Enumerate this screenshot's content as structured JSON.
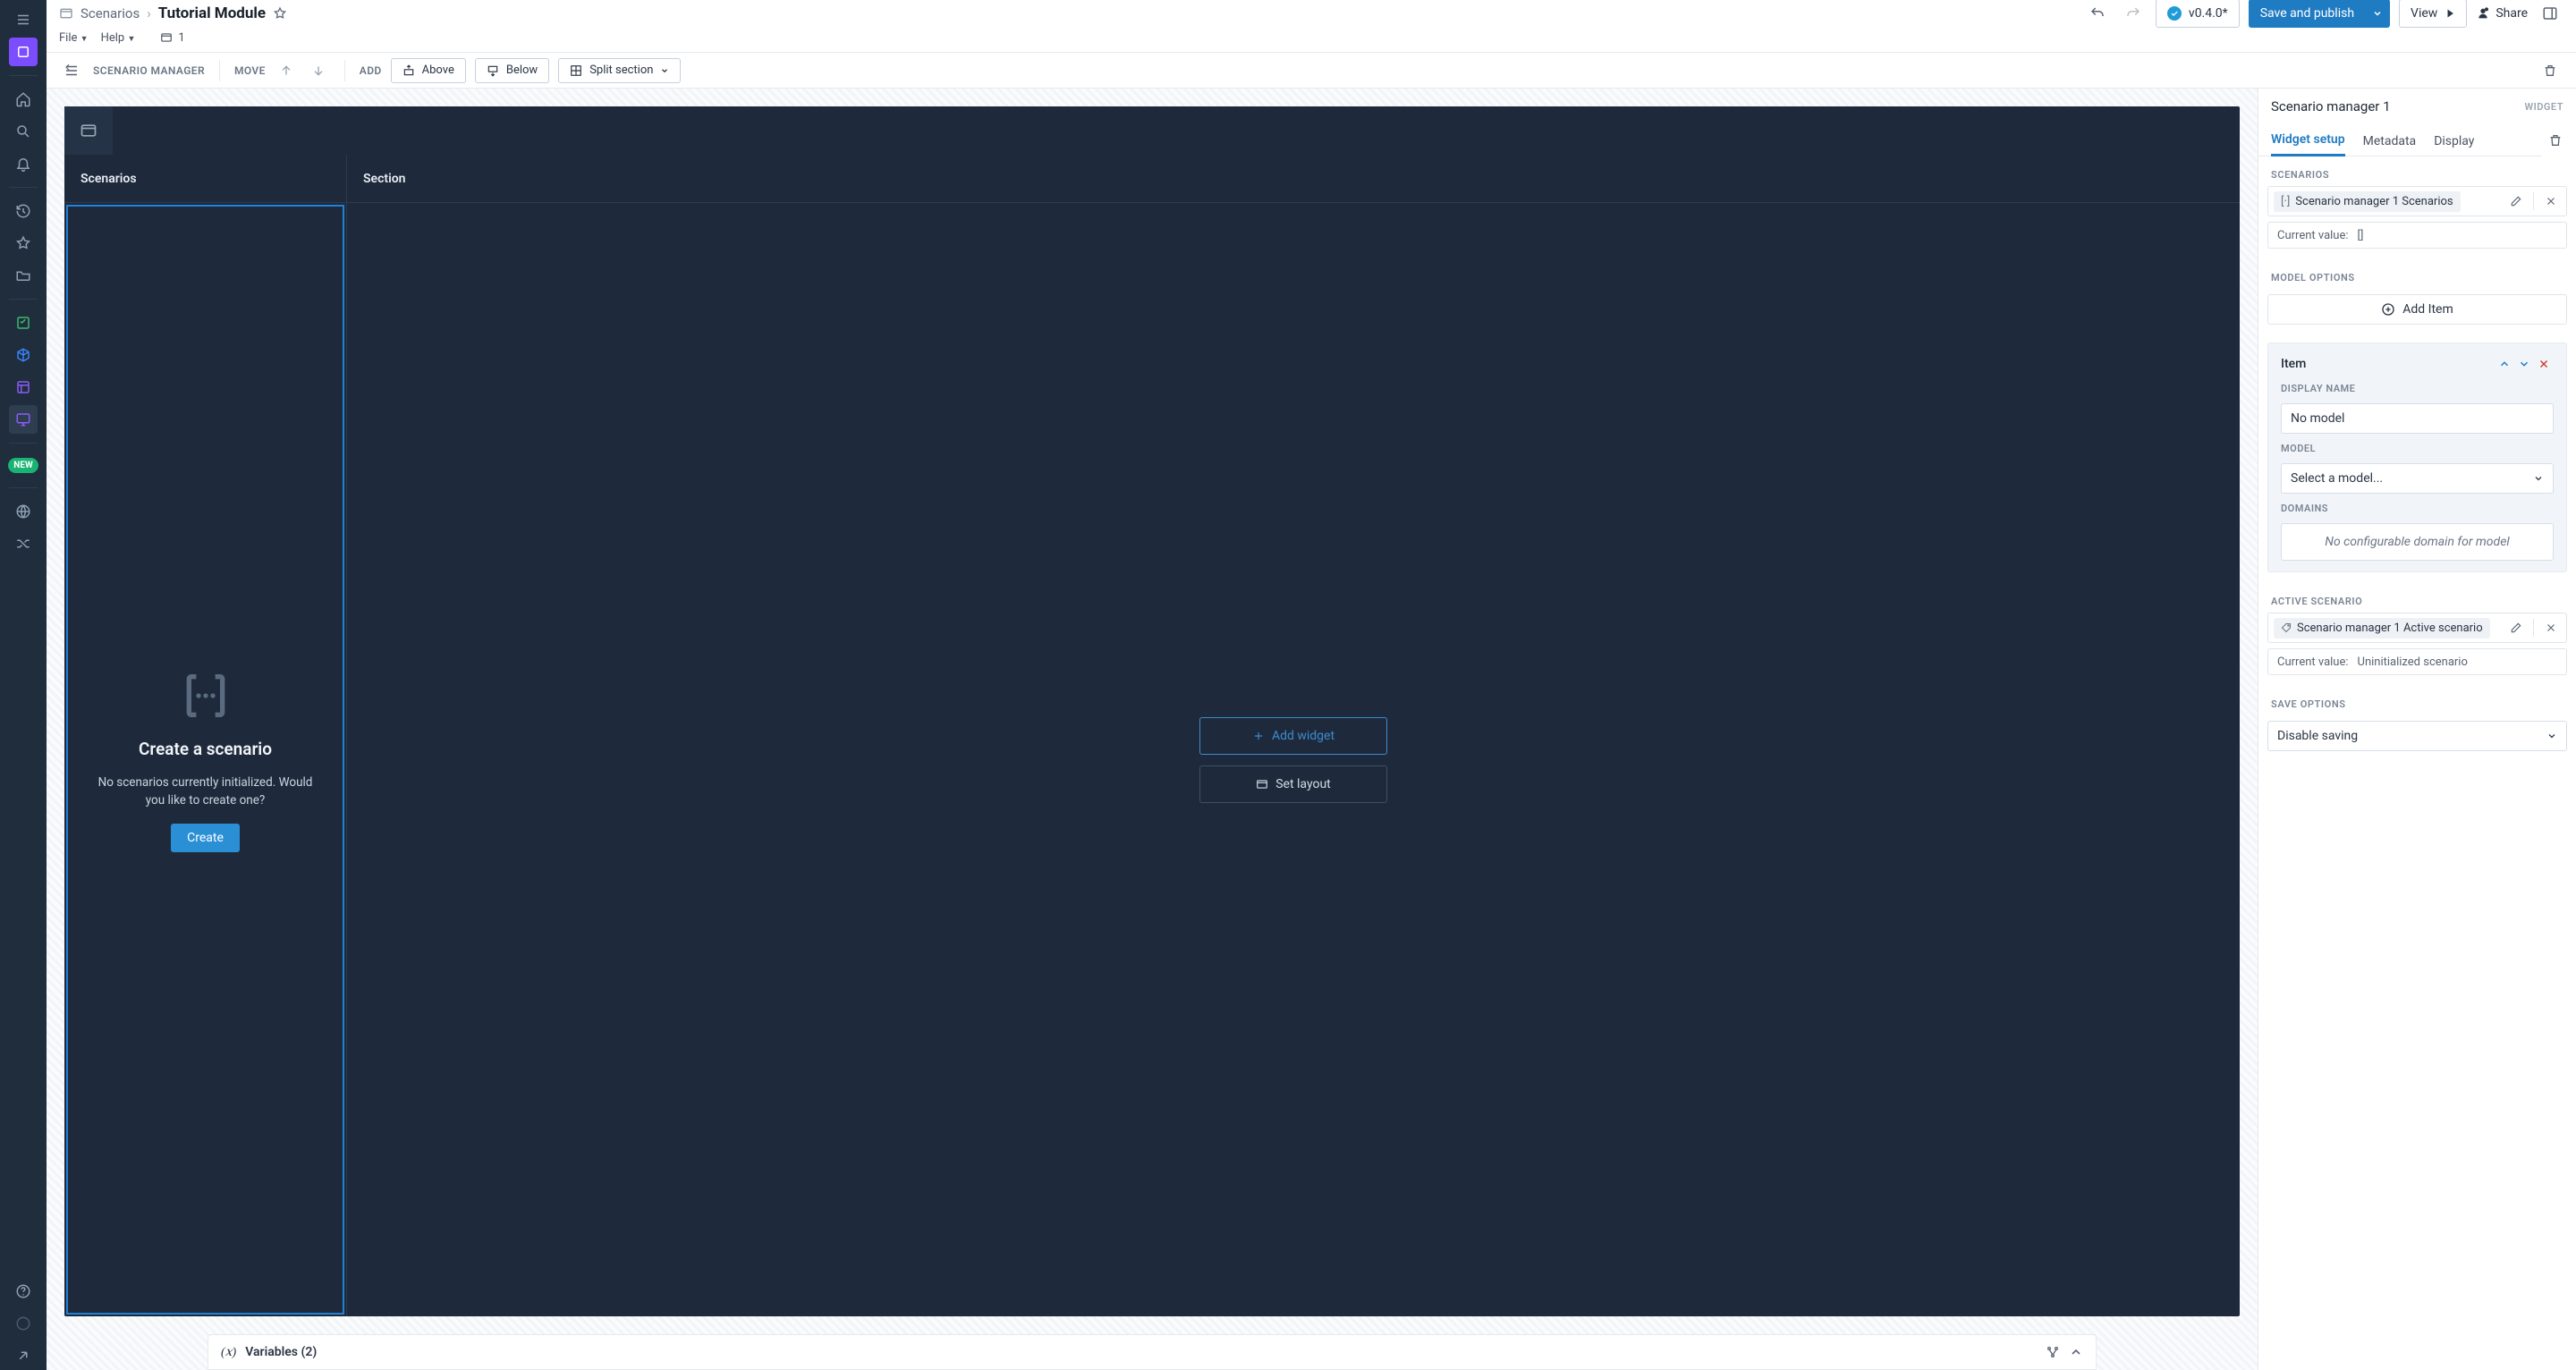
{
  "header": {
    "breadcrumb_root": "Scenarios",
    "breadcrumb_current": "Tutorial Module",
    "file_menu": "File",
    "help_menu": "Help",
    "tab_count": "1",
    "version": "v0.4.0*",
    "save_publish": "Save and publish",
    "view": "View",
    "share": "Share"
  },
  "toolbar": {
    "manager_label": "SCENARIO MANAGER",
    "move_label": "MOVE",
    "add_label": "ADD",
    "above": "Above",
    "below": "Below",
    "split": "Split section"
  },
  "canvas": {
    "col1": "Scenarios",
    "col2": "Section",
    "empty_title": "Create a scenario",
    "empty_body": "No scenarios currently initialized. Would you like to create one?",
    "create": "Create",
    "add_widget": "Add widget",
    "set_layout": "Set layout"
  },
  "vars_bar": {
    "label": "Variables (2)"
  },
  "right": {
    "title": "Scenario manager 1",
    "sub": "WIDGET",
    "tabs": {
      "setup": "Widget setup",
      "metadata": "Metadata",
      "display": "Display"
    },
    "scenarios_label": "SCENARIOS",
    "scenarios_chip": "Scenario manager 1 Scenarios",
    "cur_val_label": "Current value:",
    "cur_val_scenarios": "[]",
    "model_options_label": "MODEL OPTIONS",
    "add_item": "Add Item",
    "item_title": "Item",
    "display_name_label": "DISPLAY NAME",
    "display_name_value": "No model",
    "model_label": "MODEL",
    "model_placeholder": "Select a model...",
    "domains_label": "DOMAINS",
    "domains_empty": "No configurable domain for model",
    "active_scenario_label": "ACTIVE SCENARIO",
    "active_chip": "Scenario manager 1 Active scenario",
    "cur_active": "Uninitialized scenario",
    "save_options_label": "SAVE OPTIONS",
    "save_value": "Disable saving"
  },
  "rail": {
    "new_badge": "NEW"
  }
}
